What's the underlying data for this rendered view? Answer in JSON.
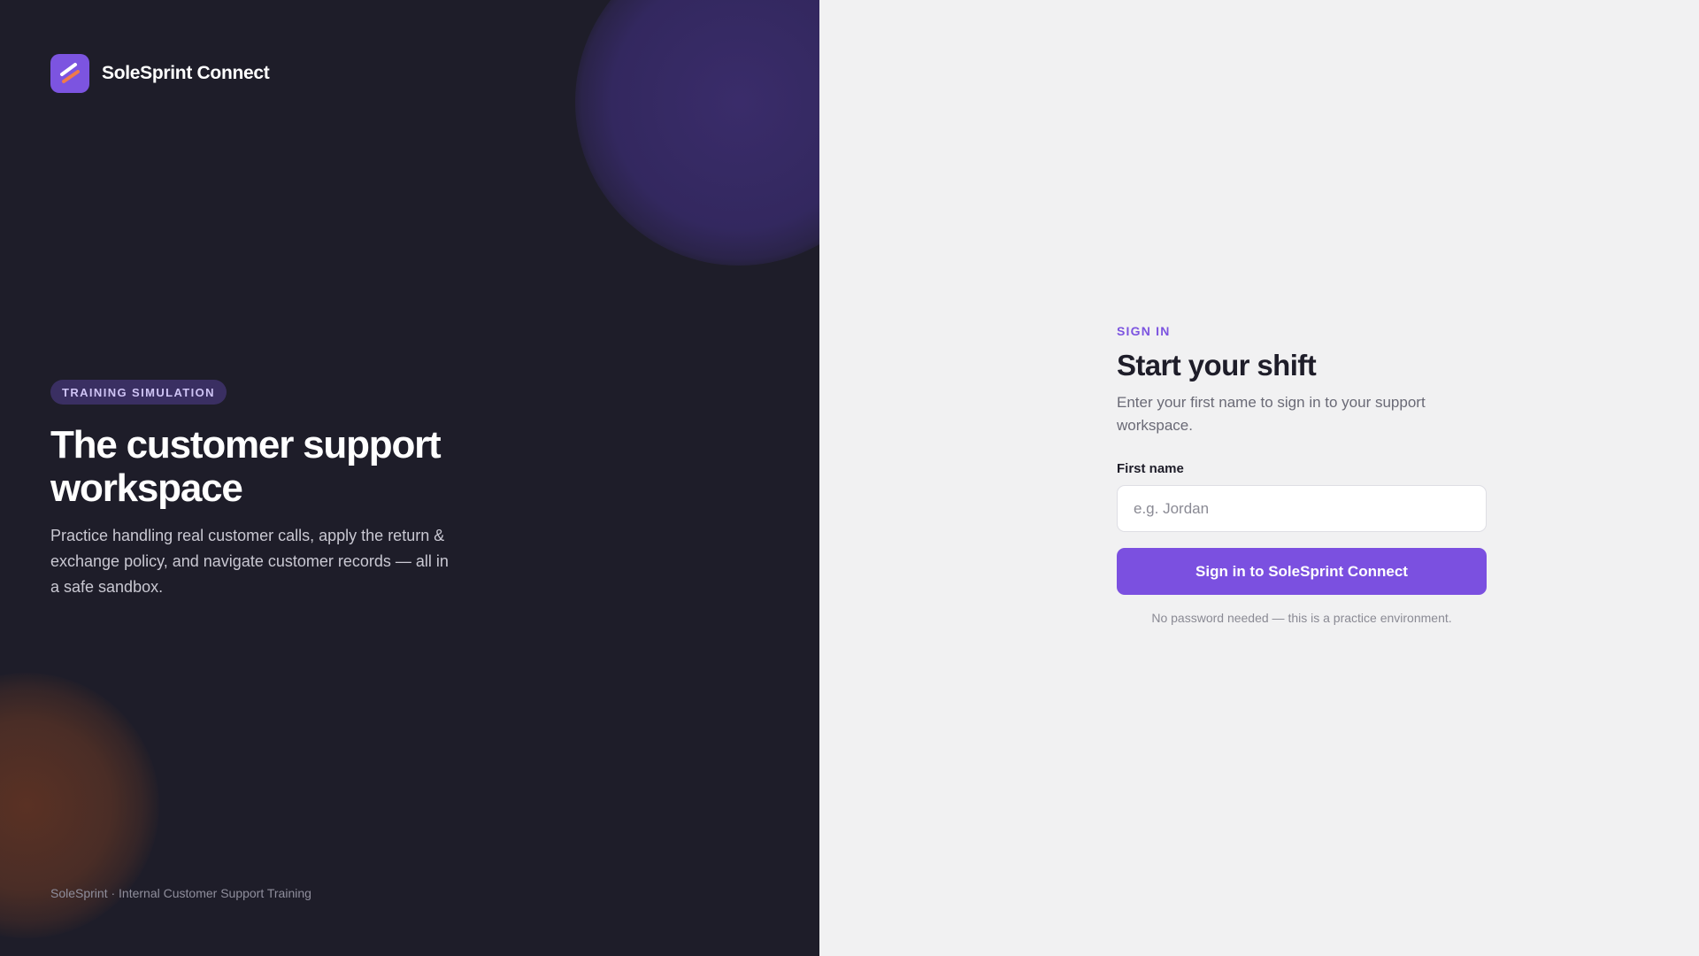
{
  "brand": {
    "name": "SoleSprint Connect",
    "logo_icon": "stripes-logo-icon"
  },
  "hero": {
    "badge": "TRAINING SIMULATION",
    "title": "The customer support workspace",
    "description": "Practice handling real customer calls, apply the return & exchange policy, and navigate customer records — all in a safe sandbox."
  },
  "footer": {
    "note": "SoleSprint · Internal Customer Support Training"
  },
  "signin": {
    "eyebrow": "SIGN IN",
    "title": "Start your shift",
    "subtitle": "Enter your first name to sign in to your support workspace.",
    "field_label": "First name",
    "field_placeholder": "e.g. Jordan",
    "field_value": "",
    "submit_label": "Sign in to SoleSprint Connect",
    "hint": "No password needed — this is a practice environment."
  },
  "colors": {
    "accent": "#7b50e0",
    "left_background": "#1e1d29",
    "right_background": "#f1f1f2",
    "badge_background": "#3a2f62"
  }
}
